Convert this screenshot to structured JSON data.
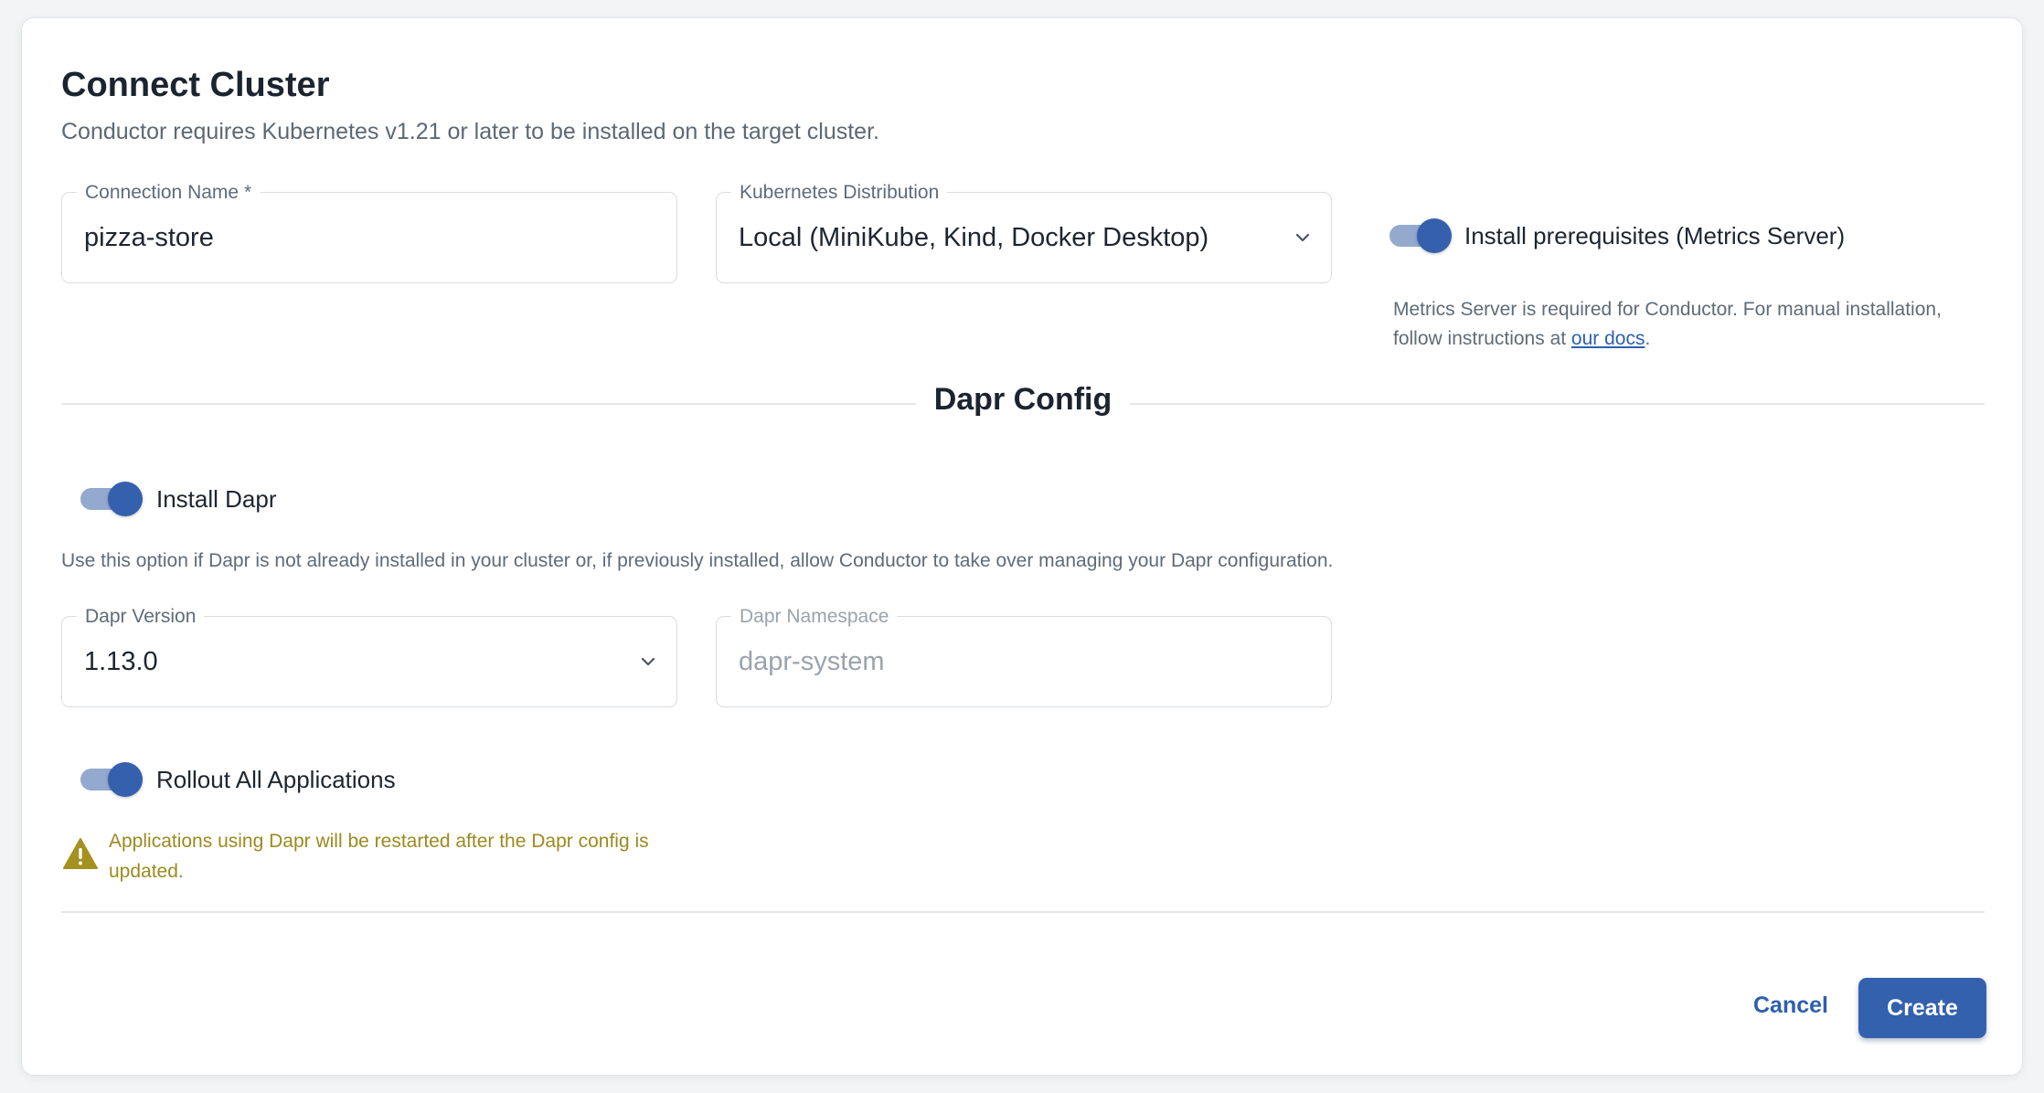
{
  "dialog": {
    "title": "Connect Cluster",
    "subtitle": "Conductor requires Kubernetes v1.21 or later to be installed on the target cluster."
  },
  "connection_name": {
    "label": "Connection Name",
    "required_mark": "*",
    "value": "pizza-store"
  },
  "kubernetes_distribution": {
    "label": "Kubernetes Distribution",
    "selected": "Local (MiniKube, Kind, Docker Desktop)"
  },
  "prerequisites": {
    "toggle_label": "Install prerequisites (Metrics Server)",
    "enabled": true,
    "hint_before": "Metrics Server is required for Conductor. For manual installation, follow instructions at ",
    "hint_link": "our docs",
    "hint_after": "."
  },
  "dapr_config": {
    "section_title": "Dapr Config",
    "install": {
      "toggle_label": "Install Dapr",
      "enabled": true,
      "hint": "Use this option if Dapr is not already installed in your cluster or, if previously installed, allow Conductor to take over managing your Dapr configuration."
    },
    "version": {
      "label": "Dapr Version",
      "selected": "1.13.0"
    },
    "namespace": {
      "label": "Dapr Namespace",
      "placeholder": "dapr-system"
    },
    "rollout": {
      "toggle_label": "Rollout All Applications",
      "enabled": true,
      "warning": "Applications using Dapr will be restarted after the Dapr config is updated."
    }
  },
  "actions": {
    "cancel_label": "Cancel",
    "create_label": "Create"
  },
  "colors": {
    "primary": "#3461ad",
    "warning": "#9b8a1f",
    "toggle_track": "#93a9cd"
  }
}
